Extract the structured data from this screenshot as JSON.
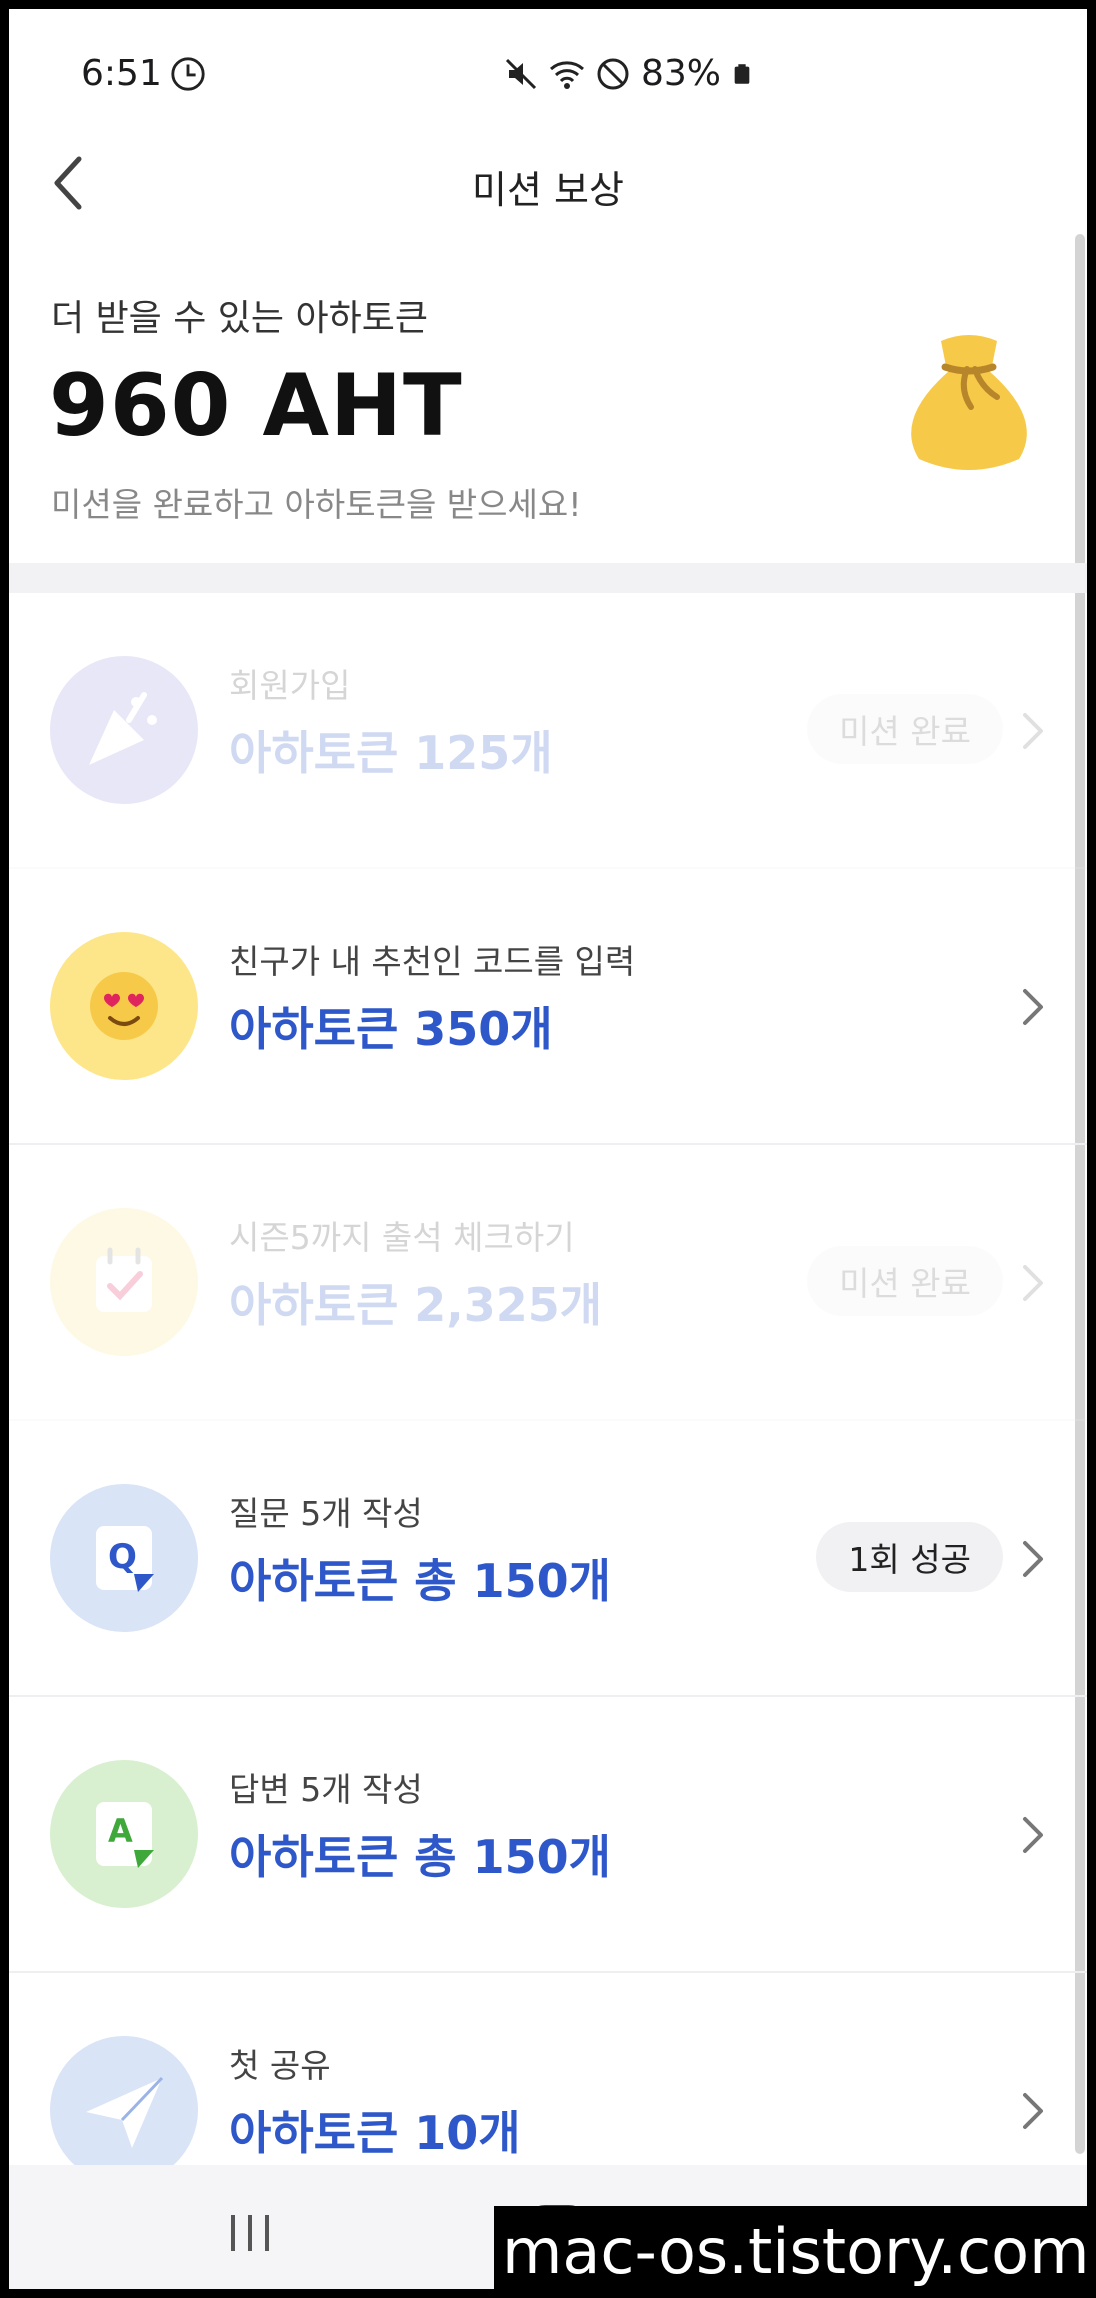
{
  "status": {
    "time": "6:51",
    "battery": "83%",
    "icons": [
      "alarm-clock-icon",
      "mute-icon",
      "wifi-icon",
      "do-not-disturb-icon",
      "battery-icon"
    ]
  },
  "header": {
    "title": "미션 보상",
    "back_icon": "chevron-left-icon"
  },
  "summary": {
    "label": "더 받을 수 있는 아하토큰",
    "amount": "960 AHT",
    "subtitle": "미션을 완료하고 아하토큰을 받으세요!",
    "icon": "money-bag-icon"
  },
  "missions": [
    {
      "title": "회원가입",
      "reward": "아하토큰 125개",
      "badge": "미션 완료",
      "done": true,
      "icon": "party-popper-icon",
      "icon_bg": "#9795dc"
    },
    {
      "title": "친구가 내 추천인 코드를 입력",
      "reward": "아하토큰 350개",
      "badge": "",
      "done": false,
      "icon": "heart-eyes-emoji-icon",
      "icon_bg": "#fde68a"
    },
    {
      "title": "시즌5까지 출석 체크하기",
      "reward": "아하토큰 2,325개",
      "badge": "미션 완료",
      "done": true,
      "icon": "calendar-check-icon",
      "icon_bg": "#fde68a"
    },
    {
      "title": "질문 5개 작성",
      "reward": "아하토큰 총 150개",
      "badge": "1회 성공",
      "done": false,
      "icon": "question-card-icon",
      "icon_bg": "#d9e4f7"
    },
    {
      "title": "답변 5개 작성",
      "reward": "아하토큰 총 150개",
      "badge": "",
      "done": false,
      "icon": "answer-card-icon",
      "icon_bg": "#d8f0cf"
    },
    {
      "title": "첫 공유",
      "reward": "아하토큰 10개",
      "badge": "",
      "done": false,
      "icon": "paper-plane-icon",
      "icon_bg": "#d9e4f7"
    }
  ],
  "colors": {
    "accent": "#2e57c9",
    "bag": "#f7c948"
  },
  "watermark": "mac-os.tistory.com"
}
